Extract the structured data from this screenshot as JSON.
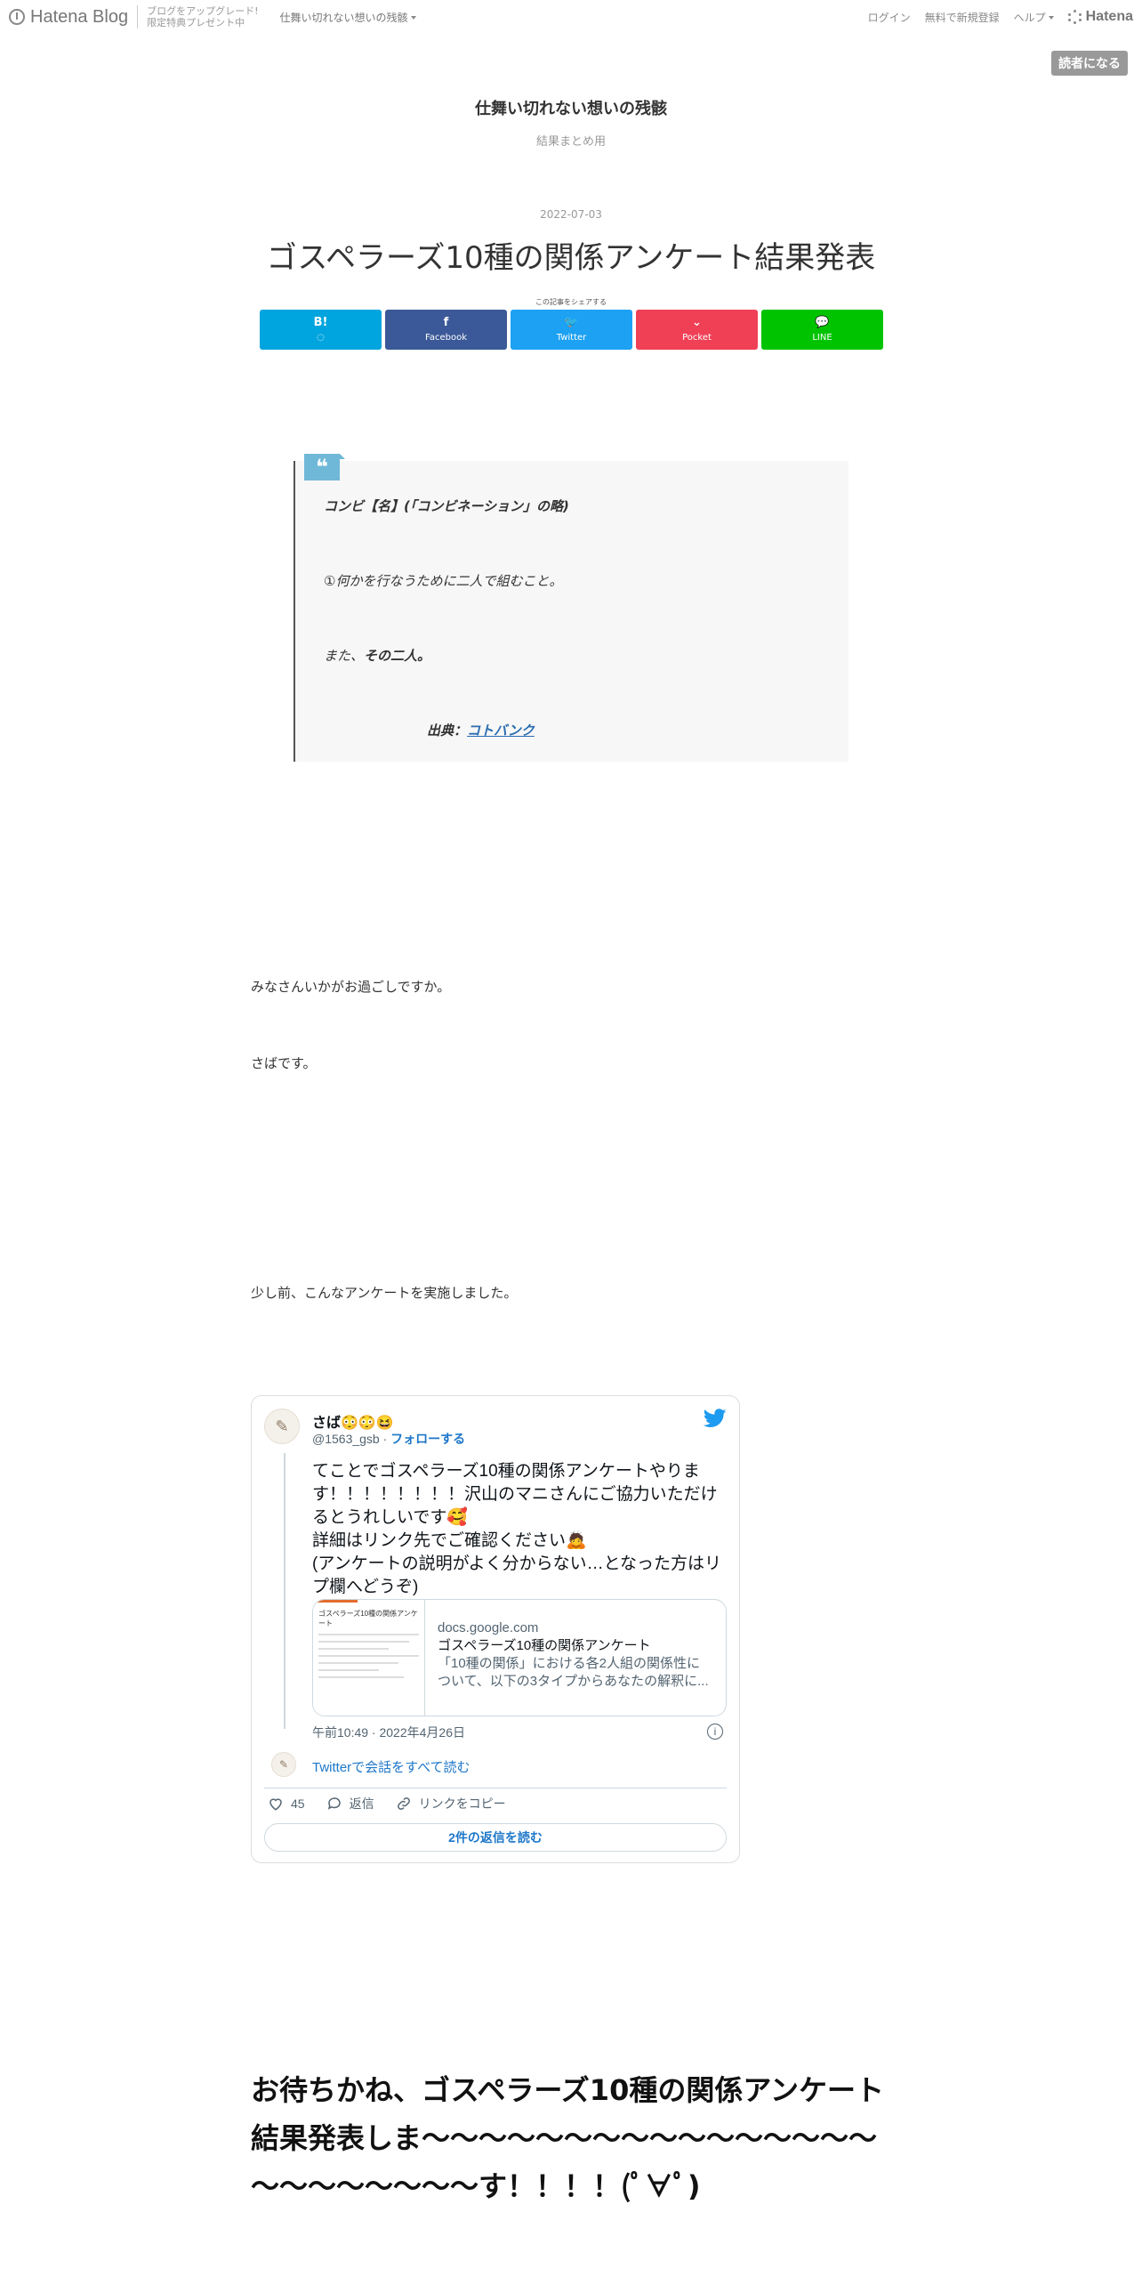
{
  "topbar": {
    "logo_text": "Hatena Blog",
    "promo_line1": "ブログをアップグレード!",
    "promo_line2": "限定特典プレゼント中",
    "blog_menu": "仕舞い切れない想いの残骸",
    "login": "ログイン",
    "signup": "無料で新規登録",
    "help": "ヘルプ",
    "brand": "Hatena"
  },
  "subscribe_label": "読者になる",
  "blog": {
    "title": "仕舞い切れない想いの残骸",
    "description": "結果まとめ用"
  },
  "entry": {
    "date": "2022-07-03",
    "title": "ゴスペラーズ10種の関係アンケート結果発表",
    "share_label": "この記事をシェアする"
  },
  "share_buttons": [
    {
      "icon": "B!",
      "label": "◌",
      "color": "#00a4de"
    },
    {
      "icon": "f",
      "label": "Facebook",
      "color": "#3b5998"
    },
    {
      "icon": "🐦",
      "label": "Twitter",
      "color": "#1da1f2"
    },
    {
      "icon": "⌄",
      "label": "Pocket",
      "color": "#ef4056"
    },
    {
      "icon": "💬",
      "label": "LINE",
      "color": "#00c300"
    }
  ],
  "quote": {
    "line1": "コンビ【名】(「コンビネーション」の略)",
    "line2": "①何かを行なうために二人で組むこと。",
    "line3_prefix": "また、",
    "line3_bold": "その二人。",
    "source_label": "出典：",
    "source_link": "コトバンク"
  },
  "paragraphs": {
    "p1": "みなさんいかがお過ごしですか。",
    "p2": "さばです。",
    "p3": "少し前、こんなアンケートを実施しました。"
  },
  "tweet": {
    "name": "さば😳😳😆",
    "handle": "@1563_gsb",
    "separator": " · ",
    "follow": "フォローする",
    "text": "てことでゴスペラーズ10種の関係アンケートやります！！！！！！！！沢山のマニさんにご協力いただけるとうれしいです🥰\n詳細はリンク先でご確認ください🙇\n(アンケートの説明がよく分からない…となった方はリプ欄へどうぞ)",
    "card": {
      "thumb_title": "ゴスペラーズ10種の関係アンケート",
      "domain": "docs.google.com",
      "title": "ゴスペラーズ10種の関係アンケート",
      "description": "「10種の関係」における各2人組の関係性について、以下の3タイプからあなたの解釈に..."
    },
    "time": "午前10:49 · 2022年4月26日",
    "read_conversation": "Twitterで会話をすべて読む",
    "likes": "45",
    "reply": "返信",
    "copy_link": "リンクをコピー",
    "read_replies": "2件の返信を読む"
  },
  "heading2": "お待ちかね、ゴスペラーズ10種の関係アンケート結果発表しま～～～～～～～～～～～～～～～～～～～～～～～～す！！！！(ﾟ∀ﾟ)"
}
